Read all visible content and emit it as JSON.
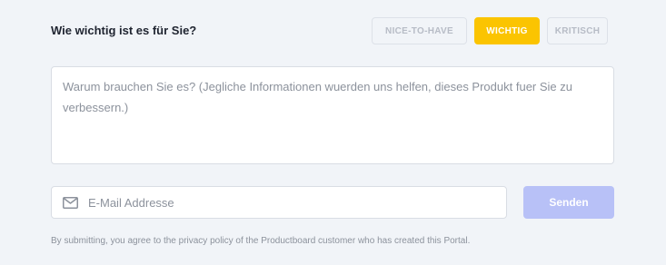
{
  "question": "Wie wichtig ist es für Sie?",
  "priority": {
    "options": [
      "NICE-TO-HAVE",
      "WICHTIG",
      "KRITISCH"
    ],
    "selected": "WICHTIG"
  },
  "reason": {
    "placeholder": "Warum brauchen Sie es? (Jegliche Informationen wuerden uns helfen, dieses Produkt fuer Sie zu verbessern.)"
  },
  "email": {
    "icon": "mail-icon",
    "placeholder": "E-Mail Addresse"
  },
  "submit": {
    "label": "Senden"
  },
  "disclaimer": "By submitting, you agree to the privacy policy of the Productboard customer who has created this Portal.",
  "colors": {
    "background": "#f1f4f8",
    "selected_priority": "#fbc401",
    "submit_disabled": "#b8c1f7"
  }
}
